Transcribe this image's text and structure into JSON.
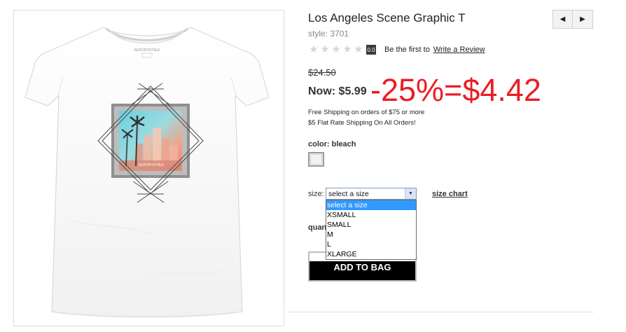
{
  "product": {
    "title": "Los Angeles Scene Graphic T",
    "style": "style: 3701",
    "image_alt": "Los Angeles Scene Graphic T in bleach"
  },
  "navigation": {
    "prev_icon": "triangle-left-icon",
    "next_icon": "triangle-right-icon"
  },
  "rating": {
    "stars": [
      "★",
      "★",
      "★",
      "★",
      "★"
    ],
    "score": "0.0",
    "prompt": "Be the first to",
    "review_link": "Write a Review",
    "star_color": "#d6d6d6"
  },
  "price": {
    "original": "$24.50",
    "now": "Now: $5.99"
  },
  "annotation": {
    "text": "-25%=$4.42",
    "color": "#ec1c24"
  },
  "shipping": {
    "line1": "Free Shipping on orders of $75 or more",
    "line2": "$5 Flat Rate Shipping On All Orders!"
  },
  "color": {
    "label": "color: bleach",
    "swatch": "#f2f2f0"
  },
  "size": {
    "label": "size:",
    "selected": "select a size",
    "options": [
      "select a size",
      "XSMALL",
      "SMALL",
      "M",
      "L",
      "XLARGE"
    ],
    "chart_link": "size chart"
  },
  "quantity": {
    "label": "quan"
  },
  "add_to_bag": {
    "label": "ADD TO BAG"
  }
}
